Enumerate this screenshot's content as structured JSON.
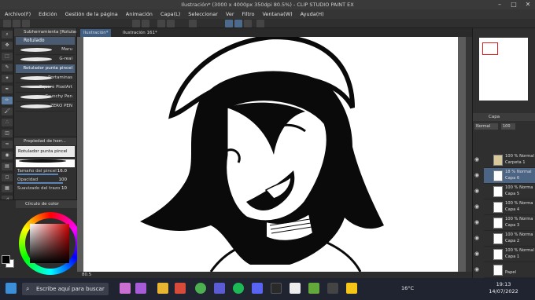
{
  "window": {
    "title": "Ilustración* (3000 x 4000px 350dpi 80.5%) - CLIP STUDIO PAINT EX"
  },
  "menu": [
    "Archivo(F)",
    "Edición",
    "Gestión de la página",
    "Animación",
    "Capa(L)",
    "Seleccionar",
    "Ver",
    "Filtro",
    "Ventana(W)",
    "Ayuda(H)"
  ],
  "subtool_panel": {
    "header": "Subherramienta [Rotulado]",
    "tab": "Rotulado",
    "brushes": [
      "Maru",
      "G-real",
      "Rotulador punta pincel",
      "Portaminas",
      "Square PixelArt",
      "Crunchy Pen",
      "ZERO PEN"
    ],
    "selected_brush": "Rotulador punta pincel"
  },
  "tool_property": {
    "header": "Propiedad de herr...",
    "title": "Rotulador punta pincel",
    "rows": [
      {
        "label": "Tamaño del pincel",
        "value": "16.0"
      },
      {
        "label": "Opacidad",
        "value": "100"
      },
      {
        "label": "Suavizado del trazo",
        "value": "10"
      }
    ]
  },
  "color_panel": {
    "header": "Círculo de color"
  },
  "canvas_tabs": [
    "Ilustración*",
    "Ilustración 161*"
  ],
  "status": {
    "zoom": "80.5"
  },
  "layer_panel": {
    "header": "Capa",
    "blend": "Normal",
    "opacity": "100",
    "layers": [
      {
        "l1": "100 % Normal",
        "l2": "Carpeta 1",
        "selected": false
      },
      {
        "l1": "18 % Normal",
        "l2": "Capa 6",
        "selected": true
      },
      {
        "l1": "100 % Norma",
        "l2": "Capa 5",
        "selected": false
      },
      {
        "l1": "100 % Norma",
        "l2": "Capa 4",
        "selected": false
      },
      {
        "l1": "100 % Norma",
        "l2": "Capa 3",
        "selected": false
      },
      {
        "l1": "100 % Norma",
        "l2": "Capa 2",
        "selected": false
      },
      {
        "l1": "100 % Normal",
        "l2": "Capa 1",
        "selected": false
      },
      {
        "l1": "",
        "l2": "Papel",
        "selected": false
      }
    ]
  },
  "taskbar": {
    "search_placeholder": "Escribe aquí para buscar",
    "temperature": "16°C",
    "time": "19:13",
    "date": "14/07/2022"
  }
}
